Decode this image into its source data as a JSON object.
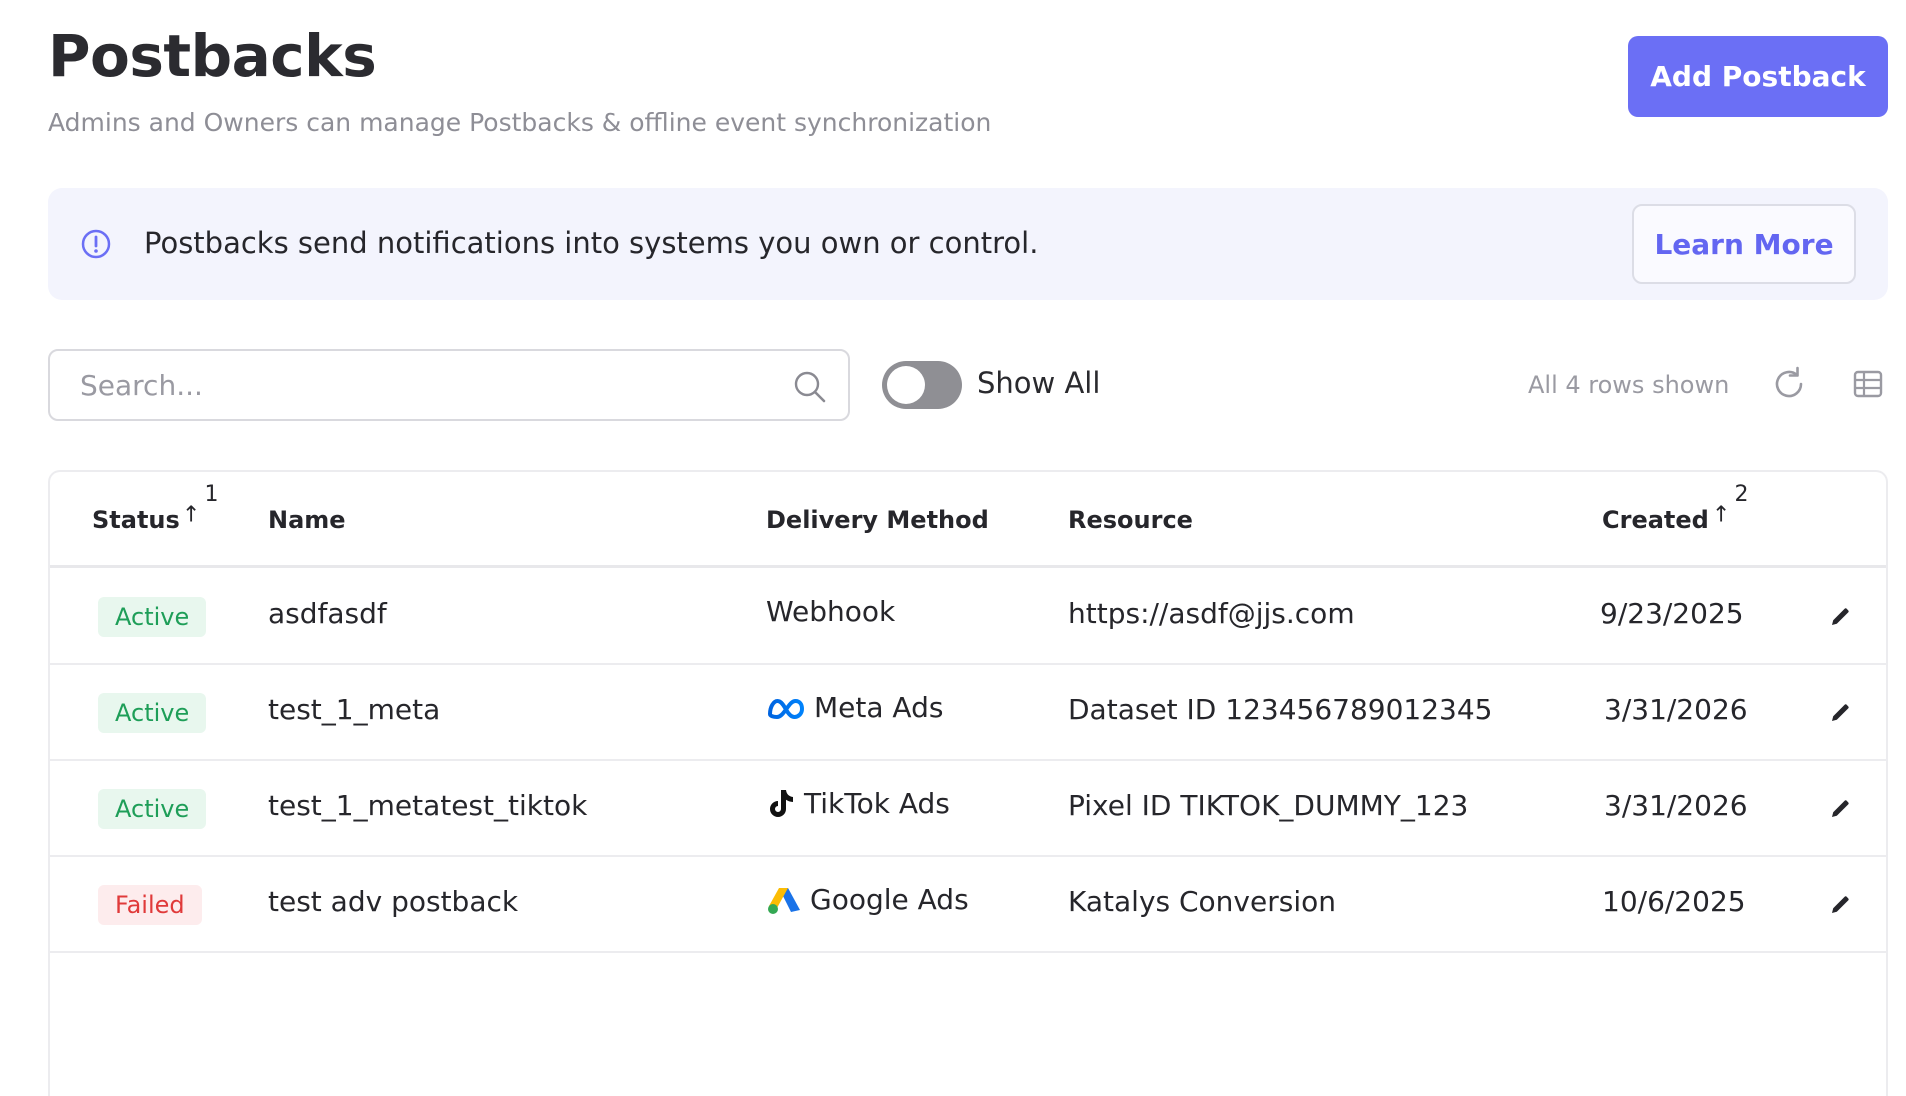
{
  "header": {
    "title": "Postbacks",
    "subtitle": "Admins and Owners can manage Postbacks & offline event synchronization",
    "add_button_label": "Add Postback"
  },
  "banner": {
    "icon": "info-circle-icon",
    "text": "Postbacks send notifications into systems you own or control.",
    "learn_more_label": "Learn More"
  },
  "toolbar": {
    "search_placeholder": "Search...",
    "search_value": "",
    "show_all_label": "Show All",
    "show_all_enabled": false,
    "rows_count_text": "All 4 rows shown",
    "refresh_icon": "refresh-icon",
    "columns_icon": "table-columns-icon"
  },
  "table": {
    "columns": [
      "Status",
      "Name",
      "Delivery Method",
      "Resource",
      "Created"
    ],
    "sort": {
      "status_order": "1",
      "created_order": "2",
      "arrow": "↑"
    },
    "rows": [
      {
        "status": "Active",
        "name": "asdfasdf",
        "method": "Webhook",
        "method_icon": "",
        "resource": "https://asdf@jjs.com",
        "created": "9/23/2025"
      },
      {
        "status": "Active",
        "name": "test_1_meta",
        "method": "Meta Ads",
        "method_icon": "meta-icon",
        "resource": "Dataset ID 123456789012345",
        "created": "3/31/2026"
      },
      {
        "status": "Active",
        "name": "test_1_metatest_tiktok",
        "method": "TikTok Ads",
        "method_icon": "tiktok-icon",
        "resource": "Pixel ID TIKTOK_DUMMY_123",
        "created": "3/31/2026"
      },
      {
        "status": "Failed",
        "name": "test adv postback",
        "method": "Google Ads",
        "method_icon": "google-ads-icon",
        "resource": "Katalys Conversion",
        "created": "10/6/2025"
      }
    ]
  },
  "colors": {
    "accent": "#6b6ff5",
    "active_bg": "#e8f7ee",
    "active_text": "#1e9e58",
    "failed_bg": "#fdeced",
    "failed_text": "#e03a3a"
  }
}
